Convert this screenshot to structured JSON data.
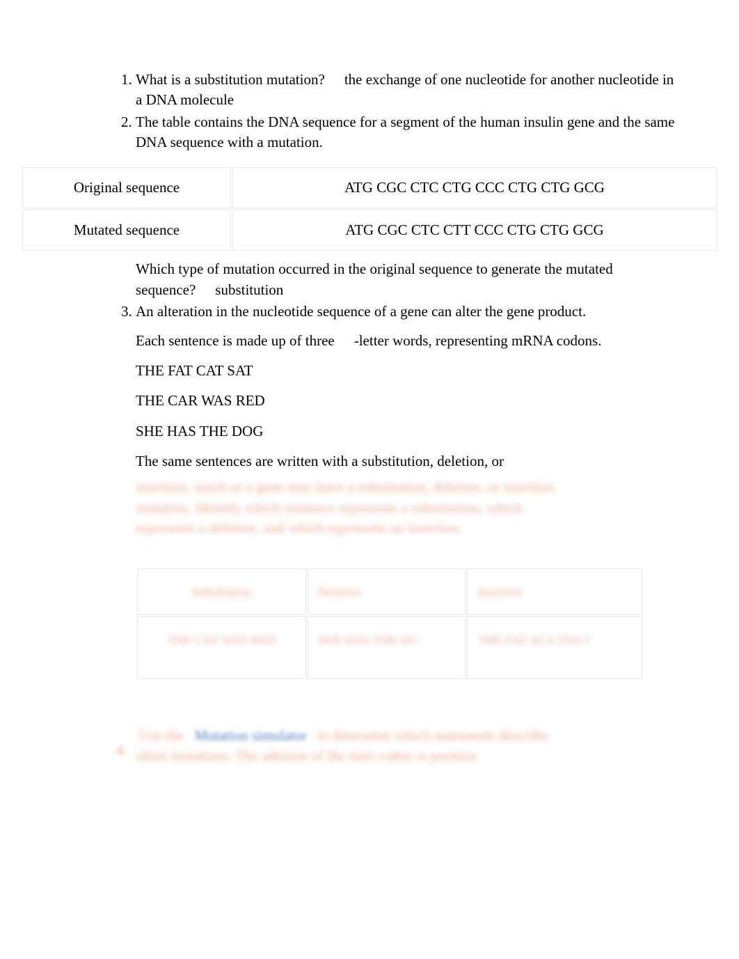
{
  "questions": {
    "q1": {
      "prompt": "What is a substitution mutation?",
      "answer": "the exchange of one nucleotide for another nucleotide in a DNA molecule"
    },
    "q2": {
      "intro": "The table contains the DNA sequence for a segment of the human insulin gene and the same DNA sequence with a mutation.",
      "table": {
        "row1_label": "Original sequence",
        "row1_value": "ATG CGC CTC CTG CCC CTG CTG GCG",
        "row2_label": "Mutated sequence",
        "row2_value": "ATG CGC CTC CTT CCC CTG CTG GCG"
      },
      "followup_prompt": "Which type of mutation occurred in the original sequence to generate the mutated sequence?",
      "followup_answer": "substitution"
    },
    "q3": {
      "intro": "An alteration in the nucleotide sequence of a gene can alter the gene product.",
      "line2a": "Each sentence is made up of three",
      "line2b": "-letter words, representing mRNA codons.",
      "sentences": {
        "s1": "THE FAT CAT SAT",
        "s2": "THE CAR WAS RED",
        "s3": "SHE HAS THE DOG"
      },
      "line3": "The same sentences are written with a substitution, deletion, or",
      "blurred1": "insertion, much as a gene may have a substitution, deletion, or insertion",
      "blurred2": "mutation. Identify which sentence represents a substitution, which",
      "blurred3": "represents a deletion, and which represents an insertion.",
      "mutation_table": {
        "h1": "Substitution",
        "h2": "Deletion",
        "h3": "Insertion",
        "c1": "THE CAT WAS RED",
        "c2": "SHE HAS THE DG",
        "c3": "THE FAT ACA TSA T"
      }
    },
    "q4": {
      "text_a": "Use the",
      "link": "Mutation simulator",
      "text_b": "to determine which statements describe",
      "text_c": "silent mutations. The adenine of the start codon is position"
    }
  }
}
